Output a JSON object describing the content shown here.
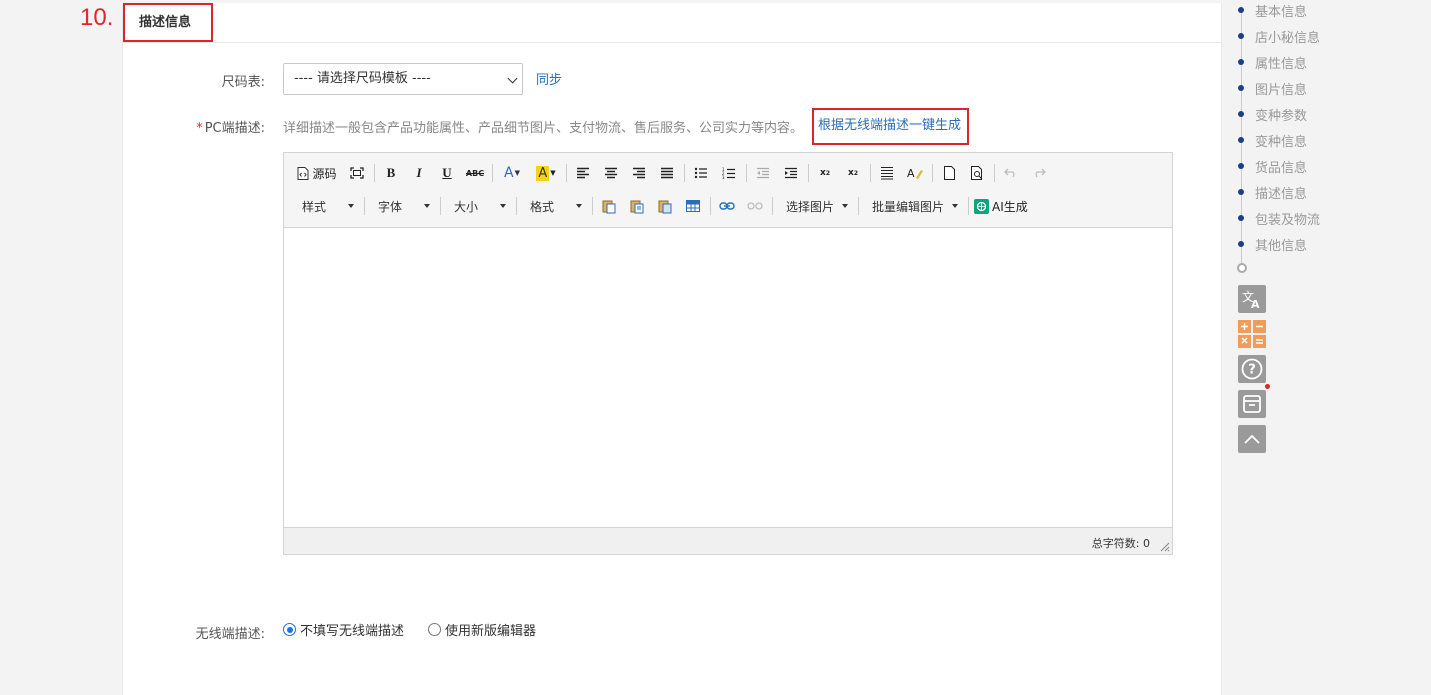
{
  "step": {
    "number": "10."
  },
  "section": {
    "title": "描述信息"
  },
  "size_chart": {
    "label": "尺码表:",
    "select_value": "---- 请选择尺码模板 ----",
    "sync_link": "同步"
  },
  "pc_desc": {
    "required_mark": "*",
    "label": "PC端描述:",
    "hint": "详细描述一般包含产品功能属性、产品细节图片、支付物流、售后服务、公司实力等内容。",
    "generate_link": "根据无线端描述一键生成"
  },
  "editor": {
    "toolbar_row1": {
      "source_label": "源码",
      "strikethrough_label": "ABC"
    },
    "toolbar_row2": {
      "style_label": "样式",
      "font_label": "字体",
      "size_label": "大小",
      "format_label": "格式",
      "select_image_label": "选择图片",
      "batch_edit_image_label": "批量编辑图片",
      "ai_generate_label": "AI生成"
    },
    "status": {
      "char_count_label": "总字符数:",
      "char_count_value": "0"
    }
  },
  "mobile_desc": {
    "label": "无线端描述:",
    "options": [
      {
        "label": "不填写无线端描述",
        "checked": true
      },
      {
        "label": "使用新版编辑器",
        "checked": false
      }
    ]
  },
  "side_nav": {
    "items": [
      "基本信息",
      "店小秘信息",
      "属性信息",
      "图片信息",
      "变种参数",
      "变种信息",
      "货品信息",
      "描述信息",
      "包装及物流",
      "其他信息"
    ]
  },
  "colors": {
    "accent": "#2a6ebb",
    "highlight_border": "#d9262c",
    "nav_dot": "#17408b"
  }
}
